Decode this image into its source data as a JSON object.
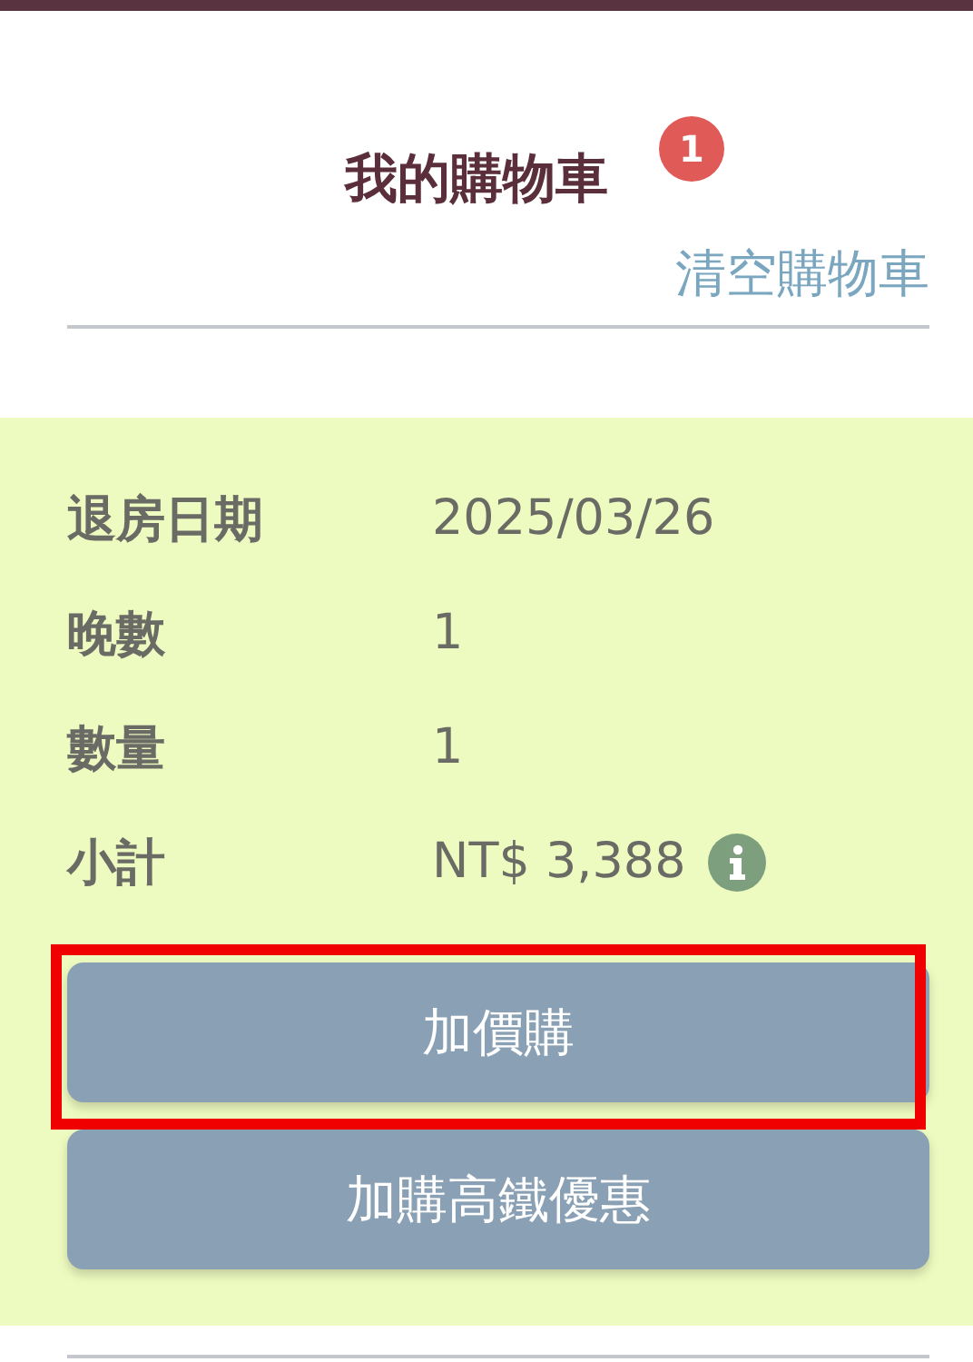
{
  "header": {
    "title": "我的購物車",
    "badge": "1",
    "clear_link": "清空購物車"
  },
  "details": [
    {
      "label": "退房日期",
      "value": "2025/03/26",
      "info": false
    },
    {
      "label": "晚數",
      "value": "1",
      "info": false
    },
    {
      "label": "數量",
      "value": "1",
      "info": false
    },
    {
      "label": "小計",
      "value": "NT$ 3,388",
      "info": true
    }
  ],
  "buttons": [
    {
      "label": "加價購",
      "highlighted": true
    },
    {
      "label": "加購高鐵優惠",
      "highlighted": false
    }
  ]
}
